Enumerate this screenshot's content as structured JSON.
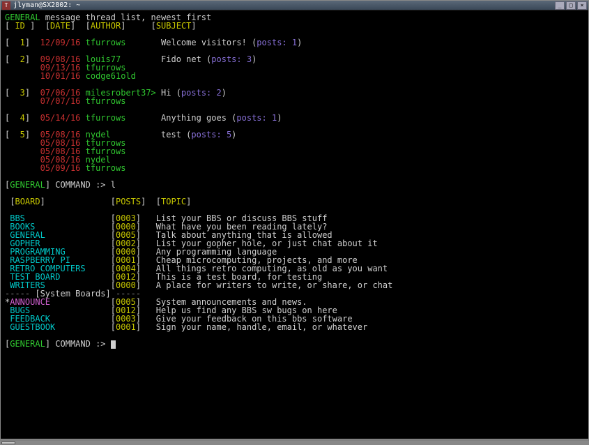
{
  "window": {
    "title": "jlyman@SX2802: ~"
  },
  "header": {
    "board": "GENERAL",
    "list_label": "message thread list, newest first",
    "cols": {
      "id": "ID",
      "date": "DATE",
      "author": "AUTHOR",
      "subject": "SUBJECT"
    }
  },
  "threads": [
    {
      "id": "1",
      "subject": "Welcome visitors!",
      "posts_label": "posts:",
      "posts": "1",
      "rows": [
        {
          "date": "12/09/16",
          "author": "tfurrows",
          "suffix": ""
        }
      ]
    },
    {
      "id": "2",
      "subject": "Fido net",
      "posts_label": "posts:",
      "posts": "3",
      "rows": [
        {
          "date": "09/08/16",
          "author": "louis77",
          "suffix": ""
        },
        {
          "date": "09/13/16",
          "author": "tfurrows",
          "suffix": ""
        },
        {
          "date": "10/01/16",
          "author": "codge61old",
          "suffix": ""
        }
      ]
    },
    {
      "id": "3",
      "subject": "Hi",
      "posts_label": "posts:",
      "posts": "2",
      "rows": [
        {
          "date": "07/06/16",
          "author": "milesrobert37",
          "suffix": ">"
        },
        {
          "date": "07/07/16",
          "author": "tfurrows",
          "suffix": ""
        }
      ]
    },
    {
      "id": "4",
      "subject": "Anything goes",
      "posts_label": "posts:",
      "posts": "1",
      "rows": [
        {
          "date": "05/14/16",
          "author": "tfurrows",
          "suffix": ""
        }
      ]
    },
    {
      "id": "5",
      "subject": "test",
      "posts_label": "posts:",
      "posts": "5",
      "rows": [
        {
          "date": "05/08/16",
          "author": "nydel",
          "suffix": ""
        },
        {
          "date": "05/08/16",
          "author": "tfurrows",
          "suffix": ""
        },
        {
          "date": "05/08/16",
          "author": "tfurrows",
          "suffix": ""
        },
        {
          "date": "05/08/16",
          "author": "nydel",
          "suffix": ""
        },
        {
          "date": "05/09/16",
          "author": "tfurrows",
          "suffix": ""
        }
      ]
    }
  ],
  "prompt1": {
    "board": "GENERAL",
    "label": "COMMAND :>",
    "value": "l"
  },
  "board_header": {
    "board": "BOARD",
    "posts": "POSTS",
    "topic": "TOPIC"
  },
  "boards": [
    {
      "name": "BBS",
      "posts": "0003",
      "topic": "List your BBS or discuss BBS stuff",
      "star": false
    },
    {
      "name": "BOOKS",
      "posts": "0000",
      "topic": "What have you been reading lately?",
      "star": false
    },
    {
      "name": "GENERAL",
      "posts": "0005",
      "topic": "Talk about anything that is allowed",
      "star": false
    },
    {
      "name": "GOPHER",
      "posts": "0002",
      "topic": "List your gopher hole, or just chat about it",
      "star": false
    },
    {
      "name": "PROGRAMMING",
      "posts": "0000",
      "topic": "Any programming language",
      "star": false
    },
    {
      "name": "RASPBERRY PI",
      "posts": "0001",
      "topic": "Cheap microcomputing, projects, and more",
      "star": false
    },
    {
      "name": "RETRO COMPUTERS",
      "posts": "0004",
      "topic": "All things retro computing, as old as you want",
      "star": false
    },
    {
      "name": "TEST BOARD",
      "posts": "0012",
      "topic": "This is a test board, for testing",
      "star": false
    },
    {
      "name": "WRITERS",
      "posts": "0000",
      "topic": "A place for writers to write, or share, or chat",
      "star": false
    }
  ],
  "system_section": {
    "label": "[System Boards]"
  },
  "system_boards": [
    {
      "name": "ANNOUNCE",
      "posts": "0005",
      "topic": "System announcements and news.",
      "star": true
    },
    {
      "name": "BUGS",
      "posts": "0012",
      "topic": "Help us find any BBS sw bugs on here",
      "star": false
    },
    {
      "name": "FEEDBACK",
      "posts": "0003",
      "topic": "Give your feedback on this bbs software",
      "star": false
    },
    {
      "name": "GUESTBOOK",
      "posts": "0001",
      "topic": "Sign your name, handle, email, or whatever",
      "star": false
    }
  ],
  "prompt2": {
    "board": "GENERAL",
    "label": "COMMAND :>"
  }
}
